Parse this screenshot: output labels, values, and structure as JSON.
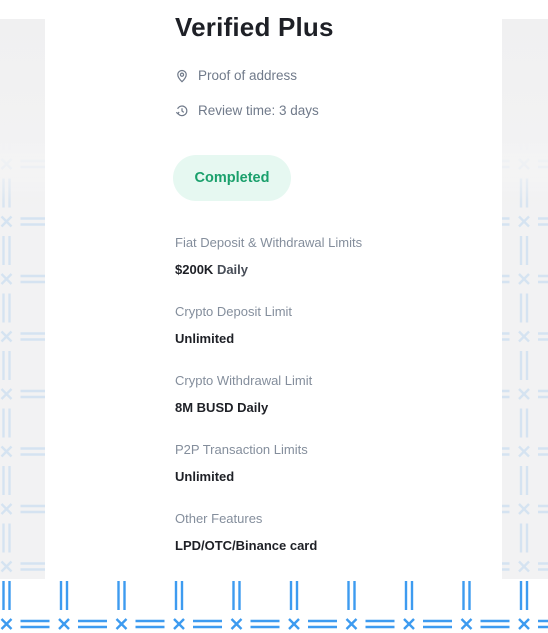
{
  "tier": {
    "title": "Verified Plus",
    "requirements": [
      {
        "icon": "location-pin-icon",
        "label": "Proof of address"
      },
      {
        "icon": "history-clock-icon",
        "label": "Review time: 3 days"
      }
    ],
    "status_badge": "Completed"
  },
  "limits": [
    {
      "label": "Fiat Deposit & Withdrawal Limits",
      "value": "$200K",
      "unit": "Daily"
    },
    {
      "label": "Crypto Deposit Limit",
      "value": "Unlimited",
      "unit": ""
    },
    {
      "label": "Crypto Withdrawal Limit",
      "value": "8M BUSD Daily",
      "unit": ""
    },
    {
      "label": "P2P Transaction Limits",
      "value": "Unlimited",
      "unit": ""
    },
    {
      "label": "Other Features",
      "value": "LPD/OTC/Binance card",
      "unit": ""
    }
  ],
  "colors": {
    "badge_bg": "#e6f8f1",
    "badge_text": "#1aa06c",
    "pattern_blue": "#3d9bf0",
    "side_panel": "#f0f0f1"
  }
}
